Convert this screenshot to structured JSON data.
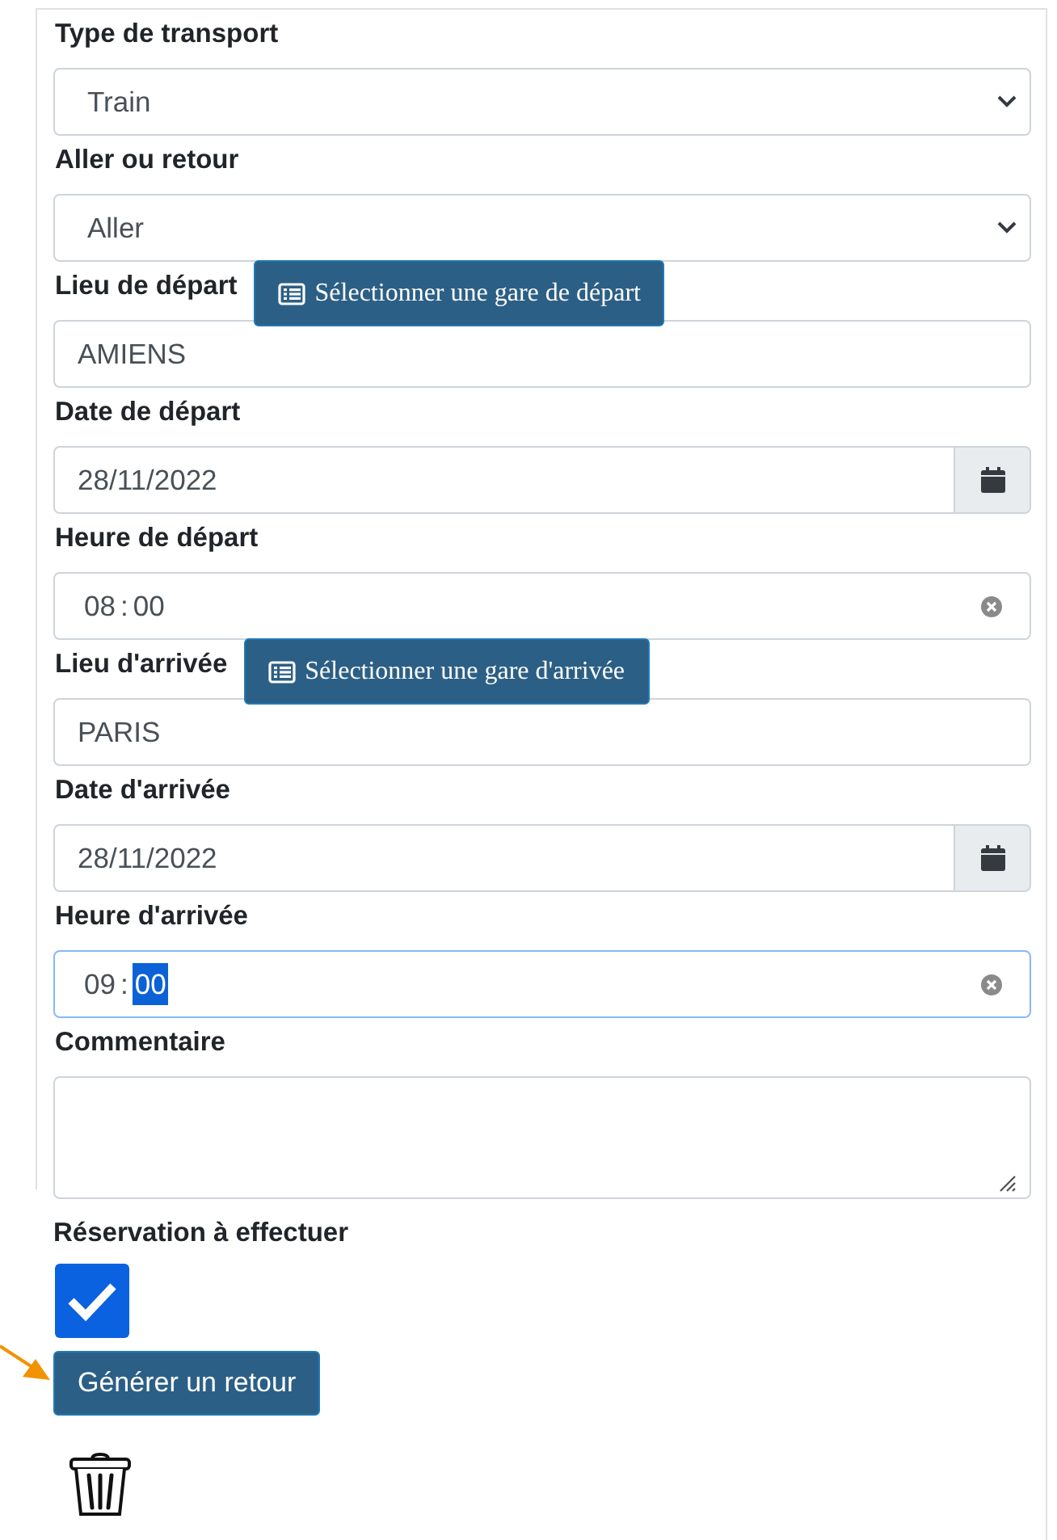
{
  "form": {
    "fields": [
      {
        "kind": "select",
        "label": "Type de transport",
        "value": "Train"
      },
      {
        "kind": "select",
        "label": "Aller ou retour",
        "value": "Aller"
      },
      {
        "kind": "text",
        "label": "Lieu de départ",
        "button": "Sélectionner une gare de départ",
        "value": "AMIENS"
      },
      {
        "kind": "date",
        "label": "Date de départ",
        "value": "28/11/2022"
      },
      {
        "kind": "time",
        "label": "Heure de départ",
        "hours": "08",
        "separator": ":",
        "minutes": "00",
        "focused": false
      },
      {
        "kind": "text",
        "label": "Lieu d'arrivée",
        "button": "Sélectionner une gare d'arrivée",
        "value": "PARIS"
      },
      {
        "kind": "date",
        "label": "Date d'arrivée",
        "value": "28/11/2022"
      },
      {
        "kind": "time",
        "label": "Heure d'arrivée",
        "hours": "09",
        "separator": ":",
        "minutes": "00",
        "focused": true
      },
      {
        "kind": "textarea",
        "label": "Commentaire"
      }
    ],
    "reservation": {
      "label": "Réservation à effectuer",
      "checked": true
    },
    "return_button": "Générer un retour"
  }
}
